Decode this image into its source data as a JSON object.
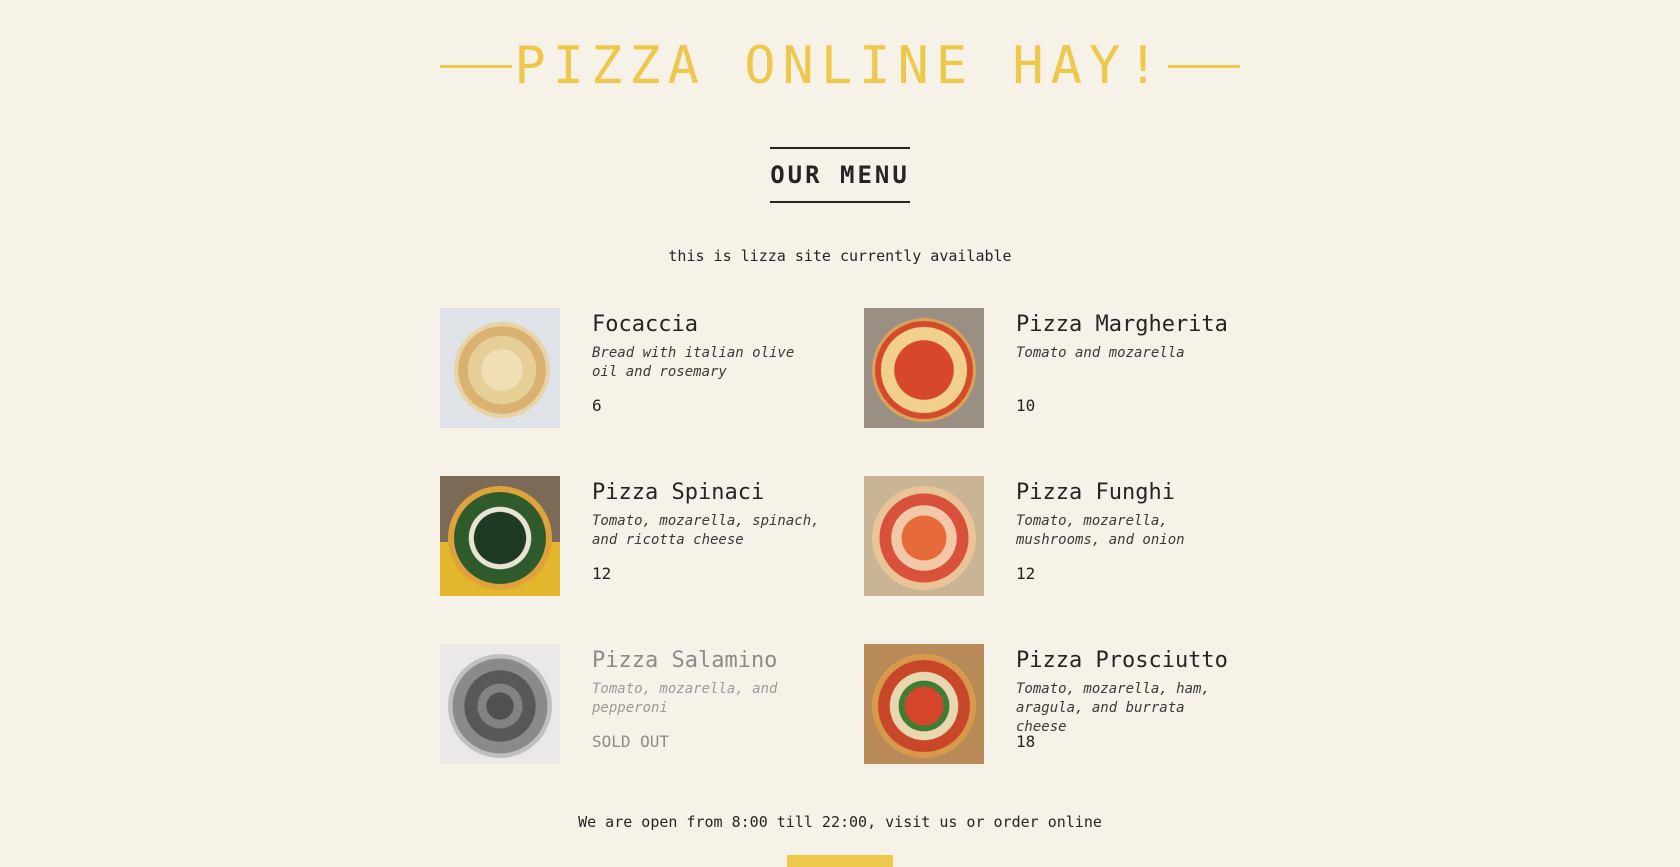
{
  "header": {
    "title": "PIZZA ONLINE HAY!"
  },
  "menu": {
    "title": "OUR MENU",
    "intro": "this is lizza site currently available",
    "items": [
      {
        "name": "Focaccia",
        "description": "Bread with italian olive oil and rosemary",
        "price": "6",
        "sold_out": false,
        "photo": "focaccia-photo"
      },
      {
        "name": "Pizza Margherita",
        "description": "Tomato and mozarella",
        "price": "10",
        "sold_out": false,
        "photo": "pizza-margherita-photo"
      },
      {
        "name": "Pizza Spinaci",
        "description": "Tomato, mozarella, spinach, and ricotta cheese",
        "price": "12",
        "sold_out": false,
        "photo": "pizza-spinaci-photo"
      },
      {
        "name": "Pizza Funghi",
        "description": "Tomato, mozarella, mushrooms, and onion",
        "price": "12",
        "sold_out": false,
        "photo": "pizza-funghi-photo"
      },
      {
        "name": "Pizza Salamino",
        "description": "Tomato, mozarella, and pepperoni",
        "price": "SOLD OUT",
        "sold_out": true,
        "photo": "pizza-salamino-photo"
      },
      {
        "name": "Pizza Prosciutto",
        "description": "Tomato, mozarella, ham, aragula, and burrata cheese",
        "price": "18",
        "sold_out": false,
        "photo": "pizza-prosciutto-photo"
      }
    ]
  },
  "footer": {
    "hours_text": "We are open from 8:00 till 22:00, visit us or order online"
  },
  "colors": {
    "accent": "#edc84b",
    "background": "#f7f2e8",
    "text": "#252525",
    "muted": "#8c8c8c"
  }
}
